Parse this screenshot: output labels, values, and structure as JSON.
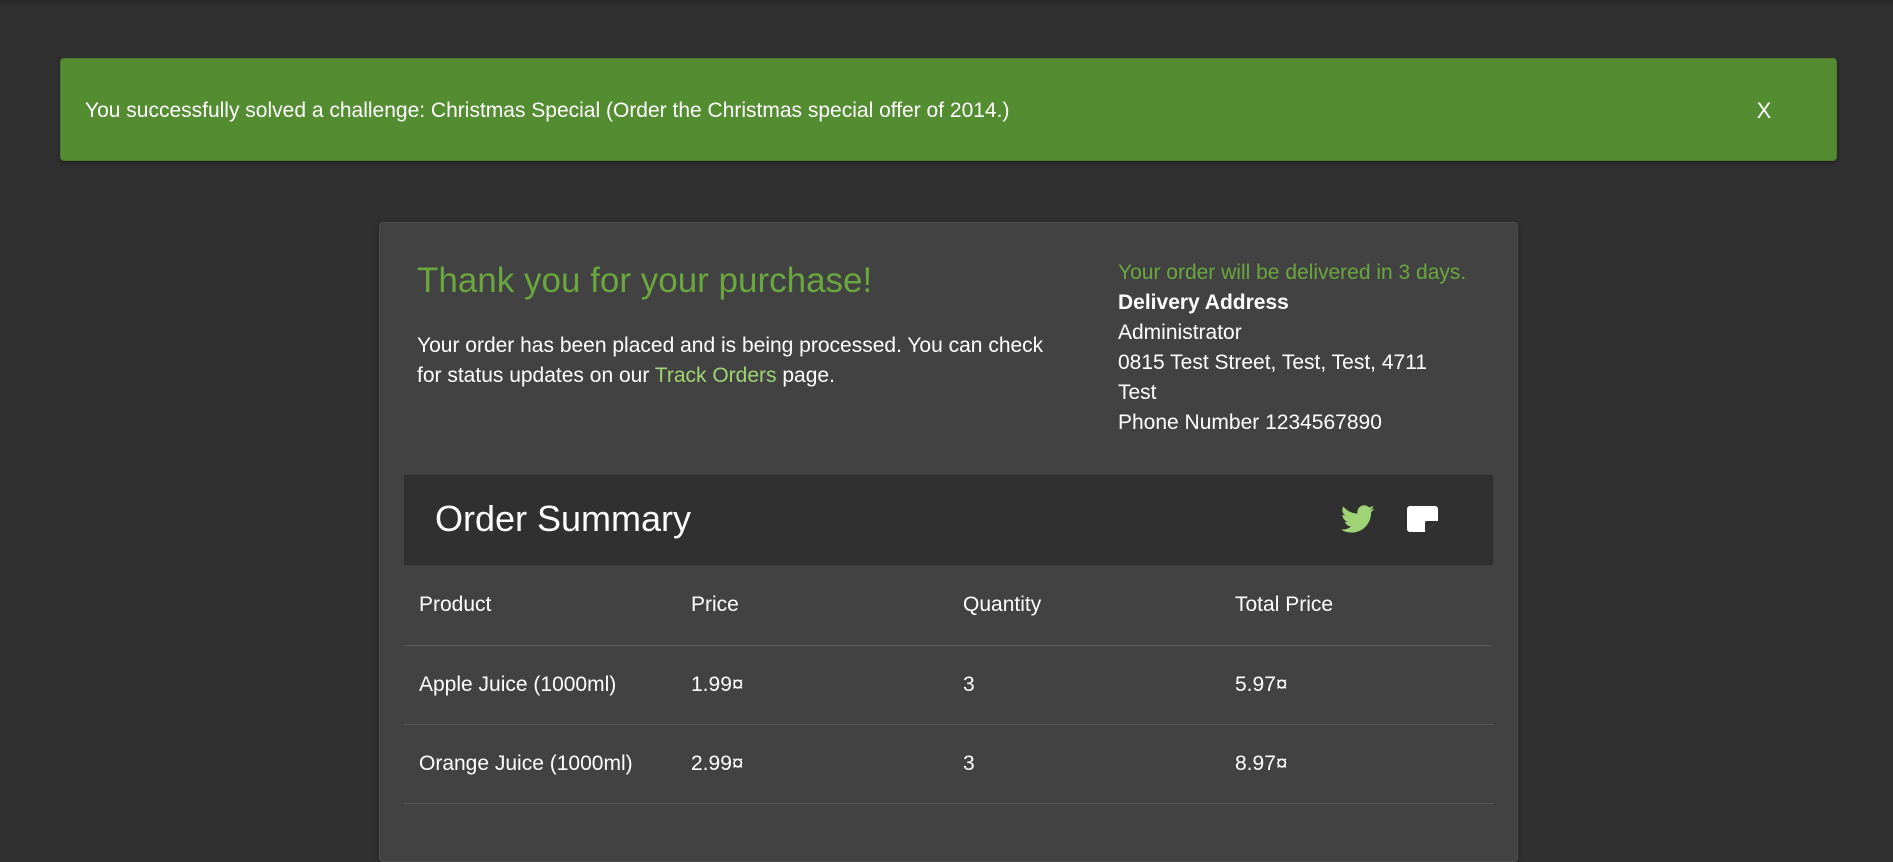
{
  "notification": {
    "message": "You successfully solved a challenge: Christmas Special (Order the Christmas special offer of 2014.)",
    "close_label": "X"
  },
  "confirmation": {
    "title": "Thank you for your purchase!",
    "message_before": "Your order has been placed and is being processed. You can check for status updates on our ",
    "link_text": "Track Orders",
    "message_after": " page."
  },
  "delivery": {
    "eta": "Your order will be delivered in 3 days.",
    "heading": "Delivery Address",
    "name": "Administrator",
    "address": "0815 Test Street, Test, Test, 4711",
    "country": "Test",
    "phone": "Phone Number 1234567890"
  },
  "summary": {
    "title": "Order Summary",
    "icons": [
      "twitter-icon",
      "note-icon"
    ]
  },
  "table": {
    "headers": [
      "Product",
      "Price",
      "Quantity",
      "Total Price"
    ],
    "rows": [
      [
        "Apple Juice (1000ml)",
        "1.99¤",
        "3",
        "5.97¤"
      ],
      [
        "Orange Juice (1000ml)",
        "2.99¤",
        "3",
        "8.97¤"
      ]
    ]
  },
  "colors": {
    "banner": "#538c31",
    "accent": "#6aa73f",
    "link": "#9ed475",
    "background": "#303030",
    "card": "#424242"
  }
}
